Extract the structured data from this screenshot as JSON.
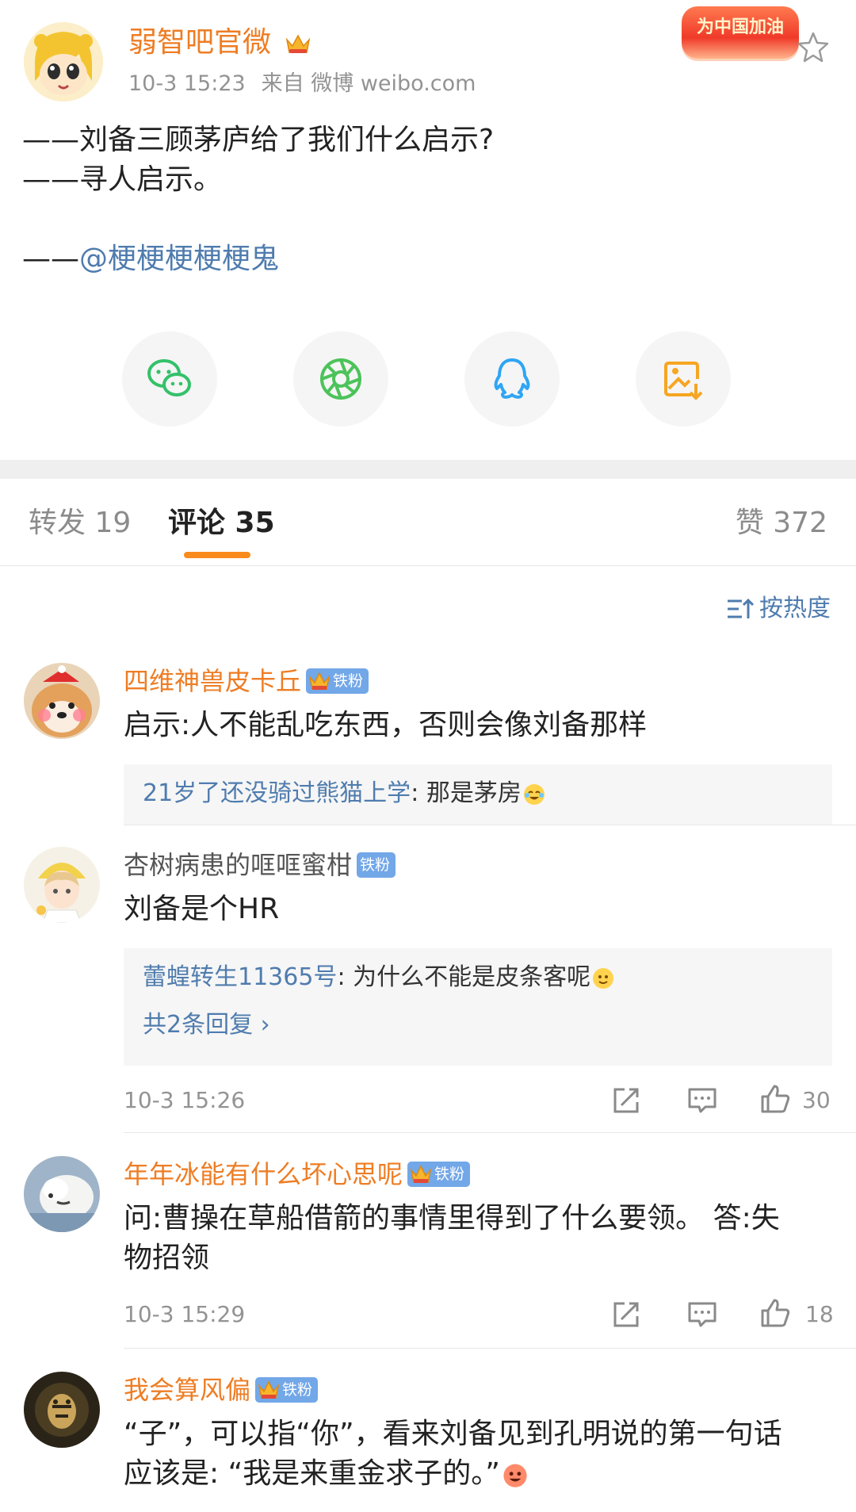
{
  "post": {
    "author": "弱智吧官微",
    "time": "10-3 15:23",
    "source": "来自 微博 weibo.com",
    "campaign_badge": "为中国加油",
    "lines": [
      "——刘备三顾茅庐给了我们什么启示?",
      "——寻人启示。"
    ],
    "credit_prefix": "——",
    "credit_mention": "@梗梗梗梗梗鬼"
  },
  "share": [
    {
      "icon": "wechat-icon"
    },
    {
      "icon": "moments-icon"
    },
    {
      "icon": "qq-icon"
    },
    {
      "icon": "save-image-icon"
    }
  ],
  "tabs": {
    "repost": "转发 19",
    "comments": "评论 35",
    "likes": "赞 372"
  },
  "sort_label": "按热度",
  "fan_badge": "铁粉",
  "comments": [
    {
      "user": "四维神兽皮卡丘",
      "text": "启示:人不能乱吃东西，否则会像刘备那样",
      "reply_user": "21岁了还没骑过熊猫上学",
      "reply_text": ": 那是茅房"
    },
    {
      "user": "杏树病患的哐哐蜜柑",
      "text": "刘备是个HR",
      "reply_user": "蕾蝗转生11365号",
      "reply_text": ": 为什么不能是皮条客呢",
      "reply_more": "共2条回复 ›",
      "time": "10-3 15:26",
      "likes": "30"
    },
    {
      "user": "年年冰能有什么坏心思呢",
      "text_lines": [
        "问:曹操在草船借箭的事情里得到了什么要领。 答:失",
        "物招领"
      ],
      "time": "10-3 15:29",
      "likes": "18"
    },
    {
      "user": "我会算风偏",
      "text_lines": [
        "“子”，可以指“你”，看来刘备见到孔明说的第一句话",
        "应该是: “我是来重金求子的。”"
      ]
    }
  ],
  "colors": {
    "username_orange": "#ee7d24",
    "link_blue": "#4f7cae",
    "tab_underline": "#f98b1d",
    "fan_badge_bg": "#72a7e8"
  }
}
